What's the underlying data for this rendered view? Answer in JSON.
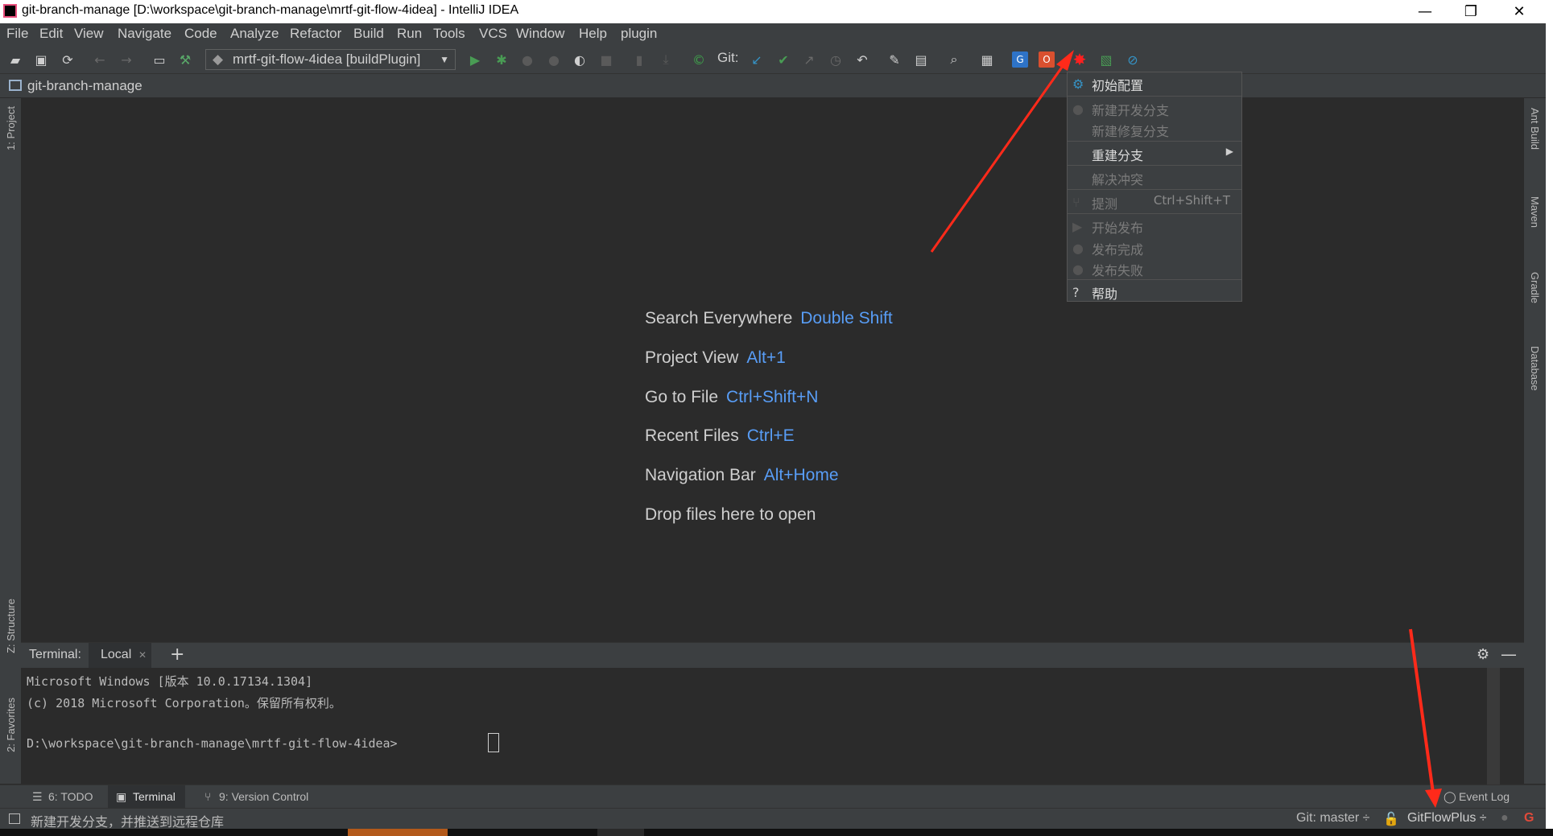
{
  "window": {
    "title": "git-branch-manage [D:\\workspace\\git-branch-manage\\mrtf-git-flow-4idea] - IntelliJ IDEA",
    "minimize": "—",
    "maximize": "❐",
    "close": "✕"
  },
  "menu": [
    "File",
    "Edit",
    "View",
    "Navigate",
    "Code",
    "Analyze",
    "Refactor",
    "Build",
    "Run",
    "Tools",
    "VCS",
    "Window",
    "Help",
    "plugin"
  ],
  "toolbar": {
    "run_config": "mrtf-git-flow-4idea [buildPlugin]",
    "git_label": "Git:"
  },
  "navbar": {
    "project": "git-branch-manage"
  },
  "left_tabs": {
    "project": "1: Project",
    "structure": "Z: Structure",
    "favorites": "2: Favorites"
  },
  "right_tabs": {
    "ant": "Ant Build",
    "maven": "Maven",
    "gradle": "Gradle",
    "database": "Database"
  },
  "hints": [
    {
      "label": "Search Everywhere",
      "key": "Double Shift"
    },
    {
      "label": "Project View",
      "key": "Alt+1"
    },
    {
      "label": "Go to File",
      "key": "Ctrl+Shift+N"
    },
    {
      "label": "Recent Files",
      "key": "Ctrl+E"
    },
    {
      "label": "Navigation Bar",
      "key": "Alt+Home"
    },
    {
      "label": "Drop files here to open",
      "key": ""
    }
  ],
  "dropdown": {
    "init": "初始配置",
    "new_dev": "新建开发分支",
    "new_fix": "新建修复分支",
    "rebuild": "重建分支",
    "resolve": "解决冲突",
    "test": "提测",
    "test_shortcut": "Ctrl+Shift+T",
    "start_release": "开始发布",
    "release_done": "发布完成",
    "release_fail": "发布失败",
    "help": "帮助"
  },
  "terminal": {
    "label": "Terminal:",
    "tab": "Local",
    "lines": [
      "Microsoft Windows [版本 10.0.17134.1304]",
      "(c) 2018 Microsoft Corporation。保留所有权利。",
      "",
      "D:\\workspace\\git-branch-manage\\mrtf-git-flow-4idea>"
    ]
  },
  "tool_tabs": {
    "todo": "6: TODO",
    "terminal": "Terminal",
    "vcs": "9: Version Control",
    "event_log": "Event Log"
  },
  "status": {
    "message": "新建开发分支，并推送到远程仓库",
    "git_branch": "Git: master ÷",
    "plugin": "GitFlowPlus ÷"
  },
  "colors": {
    "accent_key": "#589df6",
    "arrow": "#ff2a1a",
    "bg": "#2b2b2b",
    "panel": "#3c3f41"
  }
}
